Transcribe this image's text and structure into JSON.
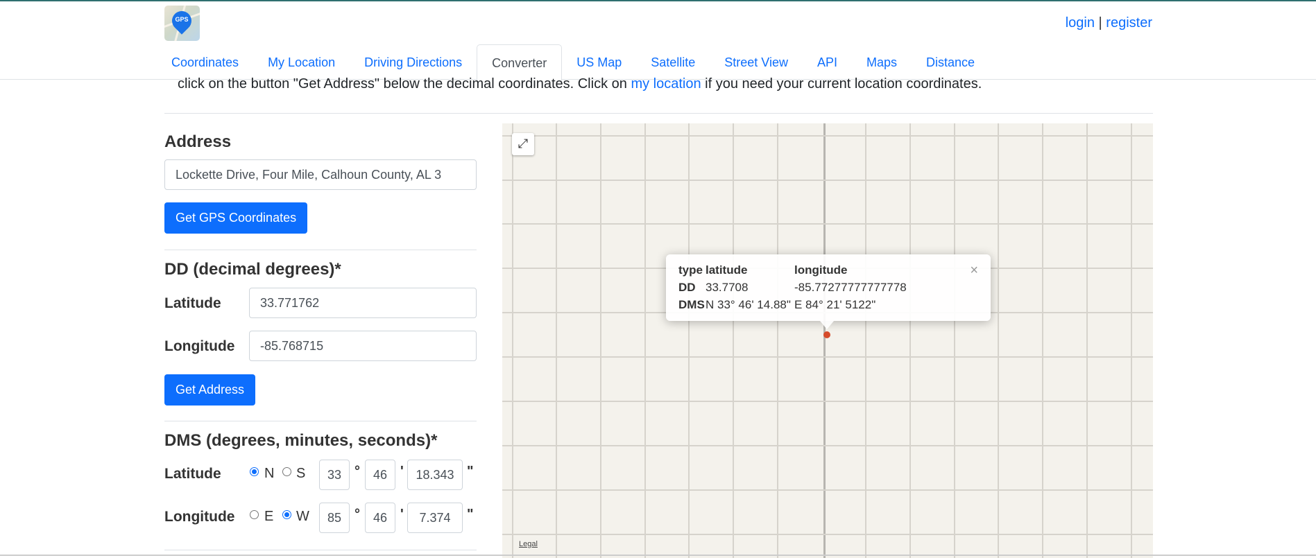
{
  "header": {
    "logo_text": "GPS",
    "login": "login",
    "separator": "|",
    "register": "register"
  },
  "tabs": [
    "Coordinates",
    "My Location",
    "Driving Directions",
    "Converter",
    "US Map",
    "Satellite",
    "Street View",
    "API",
    "Maps",
    "Distance"
  ],
  "active_tab": "Converter",
  "intro": {
    "text_before": "click on the button \"Get Address\" below the decimal coordinates. Click on ",
    "link": "my location",
    "text_after": " if you need your current location coordinates."
  },
  "address": {
    "heading": "Address",
    "value": "Lockette Drive, Four Mile, Calhoun County, AL 3",
    "button": "Get GPS Coordinates"
  },
  "dd": {
    "heading": "DD (decimal degrees)*",
    "latitude_label": "Latitude",
    "latitude_value": "33.771762",
    "longitude_label": "Longitude",
    "longitude_value": "-85.768715",
    "button": "Get Address"
  },
  "dms": {
    "heading": "DMS (degrees, minutes, seconds)*",
    "latitude_label": "Latitude",
    "lat_n": "N",
    "lat_s": "S",
    "lat_selected": "N",
    "lat_deg": "33",
    "lat_min": "46",
    "lat_sec": "18.343",
    "longitude_label": "Longitude",
    "lon_e": "E",
    "lon_w": "W",
    "lon_selected": "W",
    "lon_deg": "85",
    "lon_min": "46",
    "lon_sec": "7.374",
    "deg_symbol": "°",
    "min_symbol": "'",
    "sec_symbol": "\""
  },
  "map": {
    "legal": "Legal",
    "fullscreen_icon": "expand-icon",
    "popup": {
      "col_type": "type",
      "col_lat": "latitude",
      "col_lon": "longitude",
      "row_dd_label": "DD",
      "row_dd_lat": "33.7708",
      "row_dd_lon": "-85.77277777777778",
      "row_dms_label": "DMS",
      "row_dms_lat": "N 33° 46' 14.88\"",
      "row_dms_lon": "E 84° 21' 5122\"",
      "close": "×"
    }
  },
  "colors": {
    "primary": "#0d6efd",
    "marker": "#d64b2a",
    "map_bg": "#f4f2ec"
  }
}
